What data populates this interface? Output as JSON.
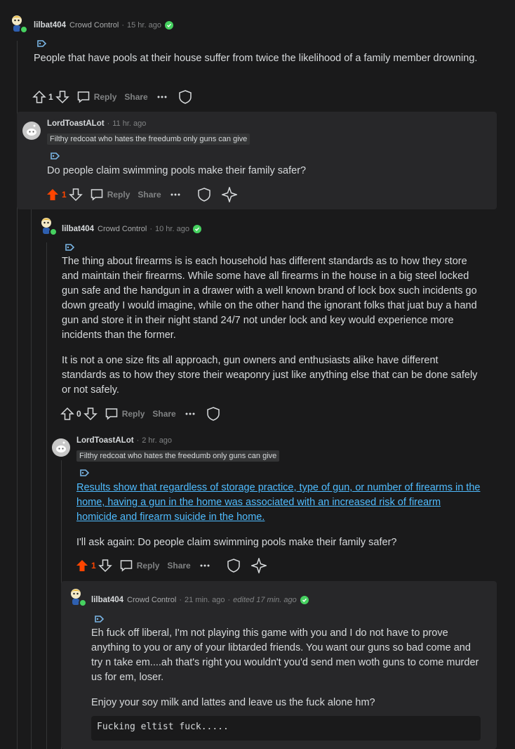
{
  "comments": [
    {
      "username": "lilbat404",
      "flair": "Crowd Control",
      "time": "15 hr. ago",
      "body": [
        "People that have pools at their house suffer from twice the likelihood of a family member drowning."
      ],
      "score": "1",
      "reply_label": "Reply",
      "share_label": "Share"
    },
    {
      "username": "LordToastALot",
      "time": "11 hr. ago",
      "flair_badge": "Filthy redcoat who hates the freedumb only guns can give",
      "body": [
        "Do people claim swimming pools make their family safer?"
      ],
      "score": "1",
      "reply_label": "Reply",
      "share_label": "Share"
    },
    {
      "username": "lilbat404",
      "flair": "Crowd Control",
      "time": "10 hr. ago",
      "body": [
        "The thing about firearms is is each household has different standards as to how they store and maintain their firearms. While some have all firearms in the house in a big steel locked gun safe and the handgun in a drawer with a well known brand of lock box such incidents go down greatly I would imagine, while on the other hand the ignorant folks that juat buy a hand gun and store it in their night stand 24/7 not under lock and key would experience more incidents than the former.",
        "It is not a one size fits all approach, gun owners and enthusiasts alike have different standards as to how they store their weaponry just like anything else that can be done safely or not safely."
      ],
      "score": "0",
      "reply_label": "Reply",
      "share_label": "Share"
    },
    {
      "username": "LordToastALot",
      "time": "2 hr. ago",
      "flair_badge": "Filthy redcoat who hates the freedumb only guns can give",
      "link_text": "Results show that regardless of storage practice, type of gun, or number of firearms in the home, having a gun in the home was associated with an increased risk of firearm homicide and firearm suicide in the home.",
      "body": [
        "I'll ask again: Do people claim swimming pools make their family safer?"
      ],
      "score": "1",
      "reply_label": "Reply",
      "share_label": "Share"
    },
    {
      "username": "lilbat404",
      "flair": "Crowd Control",
      "time": "21 min. ago",
      "edited": "edited 17 min. ago",
      "body": [
        "Eh fuck off liberal, I'm not playing this game with you and I do not have to prove anything to you or any of your libtarded friends. You want our guns so bad come and try n take em....ah that's right you wouldn't you'd send men woth guns to come murder us for em, loser.",
        "Enjoy your soy milk and lattes and leave us the fuck alone hm?"
      ],
      "code": "Fucking eltist fuck....."
    }
  ],
  "dot": "·",
  "colors": {
    "background": "#1a1a1b",
    "panel": "#272729",
    "upvote_active": "#ff4500",
    "mod_green": "#46d160",
    "link": "#4fbcff"
  },
  "icons": [
    "upvote-icon",
    "downvote-icon",
    "reply-icon",
    "more-icon",
    "shield-icon",
    "award-icon",
    "tag-icon",
    "check-icon"
  ]
}
